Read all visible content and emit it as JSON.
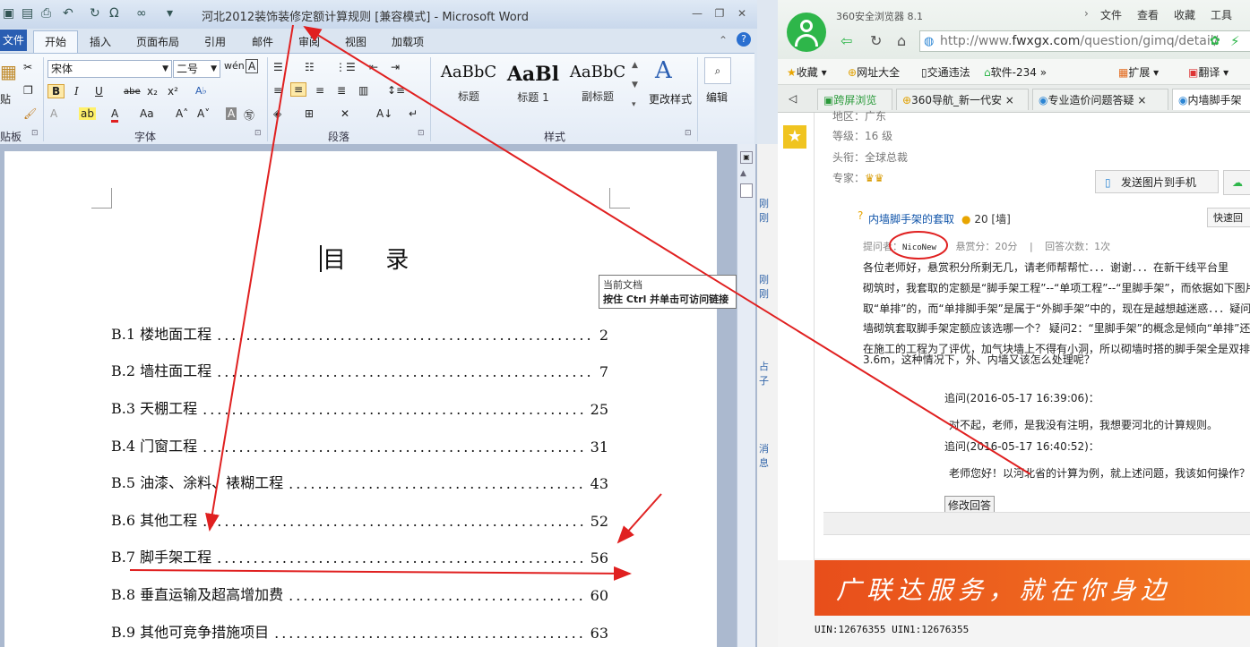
{
  "word": {
    "title": "河北2012装饰装修定额计算规则 [兼容模式] - Microsoft Word",
    "tabs": {
      "file": "文件",
      "home": "开始",
      "insert": "插入",
      "layout": "页面布局",
      "references": "引用",
      "mailings": "邮件",
      "review": "审阅",
      "view": "视图",
      "addins": "加载项"
    },
    "clipboard": {
      "paste": "贴",
      "label": "贴板"
    },
    "font": {
      "name": "宋体",
      "size": "二号",
      "label": "字体"
    },
    "paragraph": {
      "label": "段落"
    },
    "styles": {
      "label": "样式",
      "items": [
        {
          "sample": "AaBbC",
          "name": "标题"
        },
        {
          "sample": "AaBl",
          "name": "标题 1"
        },
        {
          "sample": "AaBbC",
          "name": "副标题"
        }
      ],
      "change": "更改样式"
    },
    "edit": "编辑",
    "doc": {
      "title": "目 录",
      "toc": [
        {
          "label": "B.1 楼地面工程",
          "page": "2"
        },
        {
          "label": "B.2 墙柱面工程",
          "page": "7"
        },
        {
          "label": "B.3 天棚工程",
          "page": "25"
        },
        {
          "label": "B.4 门窗工程",
          "page": "31"
        },
        {
          "label": "B.5 油漆、涂料、裱糊工程",
          "page": "43"
        },
        {
          "label": "B.6 其他工程",
          "page": "52"
        },
        {
          "label": "B.7 脚手架工程",
          "page": "56"
        },
        {
          "label": "B.8 垂直运输及超高增加费",
          "page": "60"
        },
        {
          "label": "B.9 其他可竞争措施项目",
          "page": "63"
        }
      ]
    },
    "tooltip": {
      "line1": "当前文档",
      "line2": "按住 Ctrl 并单击可访问链接"
    }
  },
  "between": {
    "items": [
      "刚刚",
      "刚刚",
      "占子",
      "消息"
    ]
  },
  "browser": {
    "name": "360安全浏览器 8.1",
    "menu": [
      "文件",
      "查看",
      "收藏",
      "工具"
    ],
    "url": {
      "scheme": "http://www.",
      "host": "fwxgx.com",
      "path": "/question/gimq/detail/"
    },
    "favorites": [
      "收藏",
      "网址大全",
      "交通违法",
      "软件-234",
      "扩展",
      "翻译"
    ],
    "tabs": [
      "跨屏浏览",
      "360导航_新一代安",
      "专业造价问题答疑",
      "内墙脚手架"
    ],
    "profile": {
      "region": "地区：广东",
      "level": "等级：16 级",
      "rank": "头衔：全球总裁",
      "expert": "专家："
    },
    "send_to_phone": "发送图片到手机",
    "question": {
      "title": "内墙脚手架的套取",
      "score": "20 [墙]",
      "quick_reply": "快速回",
      "asker_label": "提问者：",
      "asker": "NicoNew",
      "reward": "悬赏分：20分",
      "answers": "回答次数：1次",
      "body": [
        "各位老师好，悬赏积分所剩无几，请老师帮帮忙．．．谢谢．．．在新干线平台里",
        "砌筑时，我套取的定额是“脚手架工程”--“单项工程”--“里脚手架”，而依据如下图片所",
        "取“单排”的，而“单排脚手架”是属于“外脚手架”中的，现在是越想越迷惑．．．疑问",
        "墙砌筑套取脚手架定额应该选哪一个？ 疑问2：“里脚手架”的概念是倾向“单排”还",
        "在施工的工程为了评优，加气块墙上不得有小洞，所以砌墙时搭的脚手架全是双排",
        "3.6m，这种情况下，外、内墙又该怎么处理呢？"
      ]
    },
    "followups": [
      {
        "time": "追问(2016-05-17 16:39:06)：",
        "text": "对不起，老师，是我没有注明，我想要河北的计算规则。"
      },
      {
        "time": "追问(2016-05-17 16:40:52)：",
        "text": "老师您好！以河北省的计算为例，就上述问题，我该如何操作？"
      }
    ],
    "edit_answer": "修改回答",
    "banner": "广联达服务，就在你身边",
    "uin": "UIN:12676355 UIN1:12676355"
  },
  "colors": {
    "annotation": "#e02020",
    "word_blue": "#2a5eb2",
    "browser_green": "#2eb64a",
    "banner_orange": "#ec5a1c"
  }
}
